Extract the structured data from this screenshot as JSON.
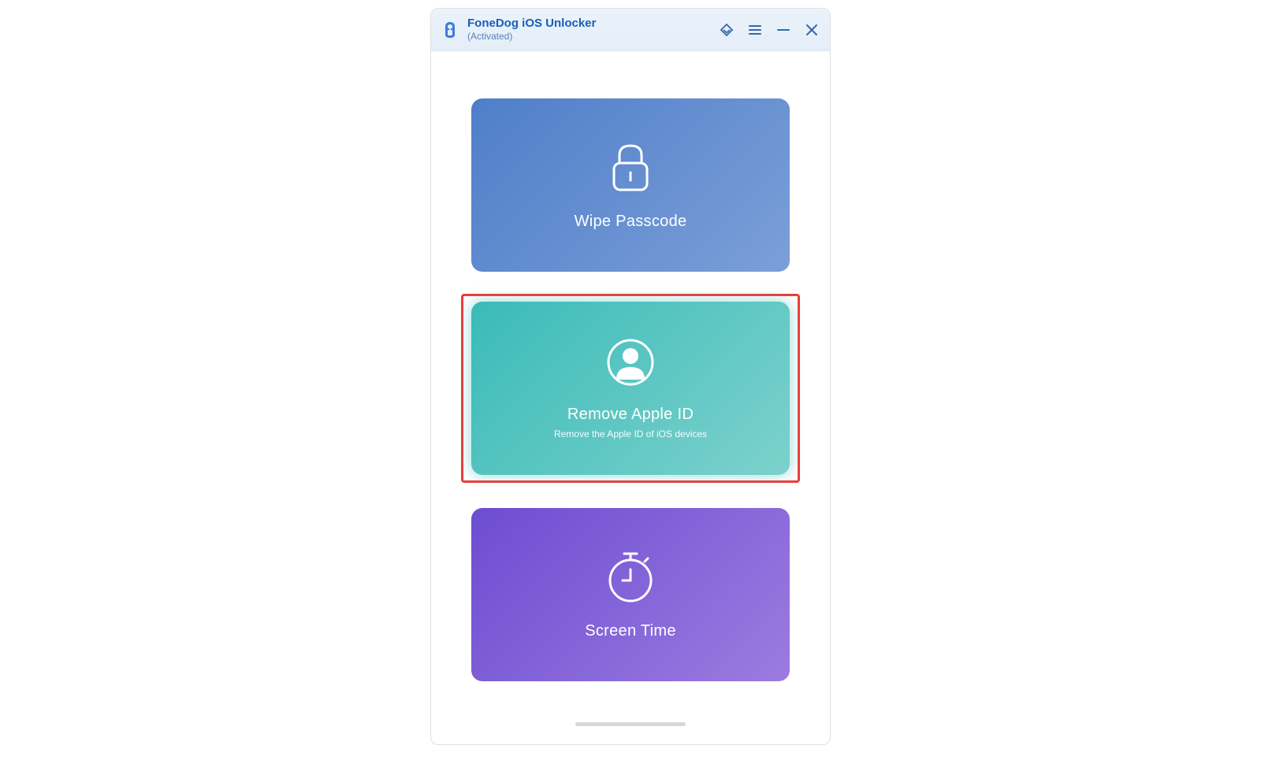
{
  "header": {
    "title": "FoneDog iOS Unlocker",
    "status": "(Activated)"
  },
  "cards": {
    "wipe_passcode": {
      "title": "Wipe Passcode"
    },
    "remove_apple_id": {
      "title": "Remove Apple ID",
      "subtitle": "Remove the Apple ID of iOS devices"
    },
    "screen_time": {
      "title": "Screen Time"
    }
  }
}
